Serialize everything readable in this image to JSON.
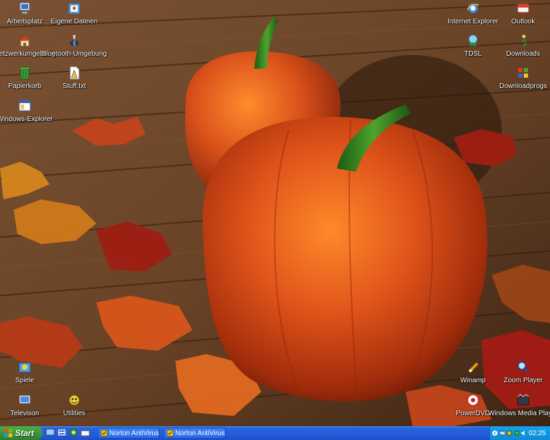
{
  "desktop": {
    "icons": [
      {
        "label": "Arbeitsplatz",
        "icon": "computer-icon"
      },
      {
        "label": "Eigene Dateien",
        "icon": "documents-folder-icon"
      },
      {
        "label": "Netzwerkumgebung",
        "icon": "network-icon"
      },
      {
        "label": "Bluetooth-Umgebung",
        "icon": "bluetooth-icon"
      },
      {
        "label": "Papierkorb",
        "icon": "recycle-bin-icon"
      },
      {
        "label": "Stuff.txt",
        "icon": "text-file-icon"
      },
      {
        "label": "Windows-Explorer",
        "icon": "explorer-icon"
      },
      {
        "label": "Internet Explorer",
        "icon": "internet-explorer-icon"
      },
      {
        "label": "Outlook",
        "icon": "outlook-icon"
      },
      {
        "label": "TDSL",
        "icon": "tdsl-icon"
      },
      {
        "label": "Downloads",
        "icon": "downloads-icon"
      },
      {
        "label": "Downloadprogs",
        "icon": "downloadprogs-icon"
      },
      {
        "label": "Spiele",
        "icon": "games-icon"
      },
      {
        "label": "Televison",
        "icon": "television-icon"
      },
      {
        "label": "Utilities",
        "icon": "utilities-icon"
      },
      {
        "label": "Winamp",
        "icon": "winamp-icon"
      },
      {
        "label": "Zoom Player",
        "icon": "zoom-player-icon"
      },
      {
        "label": "PowerDVD",
        "icon": "powerdvd-icon"
      },
      {
        "label": "Windows Media Player",
        "icon": "media-player-icon"
      }
    ]
  },
  "taskbar": {
    "start_label": "Start",
    "quick_launch": [
      "show-desktop-icon",
      "media-icon",
      "settings-icon",
      "calendar-icon"
    ],
    "tasks": [
      {
        "label": "Norton AntiVirus",
        "icon": "norton-icon"
      },
      {
        "label": "Norton AntiVirus",
        "icon": "norton-icon"
      }
    ],
    "tray_icons": [
      "chevron-left-icon",
      "network-tray-icon",
      "antivirus-tray-icon",
      "tray-green-icon",
      "volume-icon"
    ],
    "clock": "02:25"
  },
  "colors": {
    "taskbar_blue": "#245ddb",
    "start_green": "#3c9a3a",
    "tray_blue": "#0e8ad6",
    "pumpkin": "#e2541a",
    "wood": "#6b4326"
  }
}
